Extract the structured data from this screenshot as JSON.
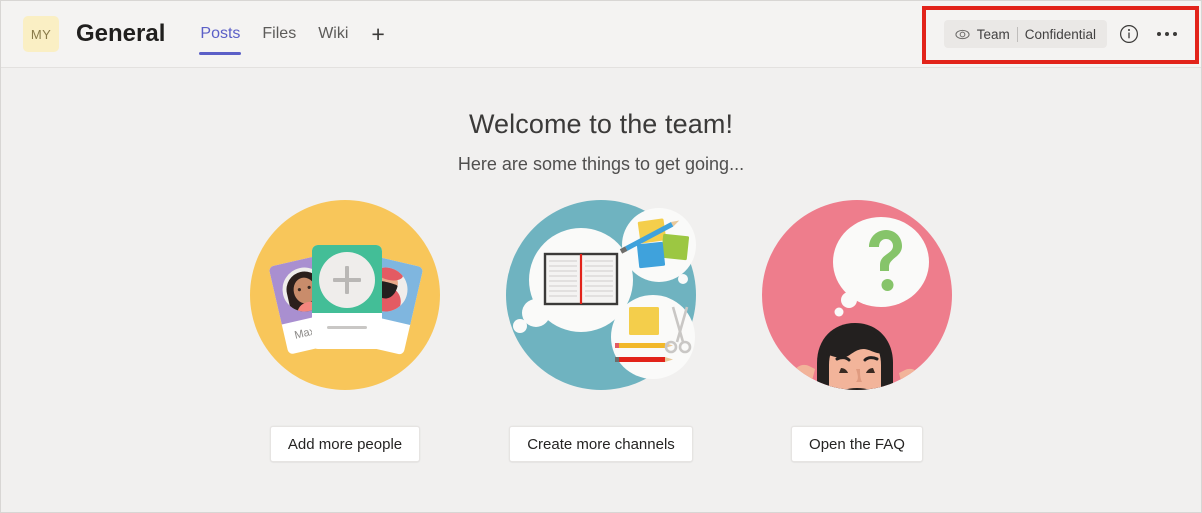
{
  "header": {
    "team_avatar_initials": "MY",
    "channel_title": "General",
    "tabs": [
      {
        "label": "Posts",
        "active": true
      },
      {
        "label": "Files",
        "active": false
      },
      {
        "label": "Wiki",
        "active": false
      }
    ],
    "add_tab_label": "+",
    "sensitivity": {
      "eye_icon": "eye-icon",
      "scope_label": "Team",
      "label": "Confidential"
    },
    "info_icon": "info-circle-icon",
    "more_icon": "ellipsis-icon"
  },
  "main": {
    "welcome_title": "Welcome to the team!",
    "welcome_subtitle": "Here are some things to get going...",
    "cards": [
      {
        "illustration": "people-cards-illustration",
        "button_label": "Add more people",
        "circle_color": "#F8C65A",
        "name_on_card": "Maxine"
      },
      {
        "illustration": "channels-notebook-illustration",
        "button_label": "Create more channels",
        "circle_color": "#6FB3C0"
      },
      {
        "illustration": "faq-question-illustration",
        "button_label": "Open the FAQ",
        "circle_color": "#EE7D8C"
      }
    ]
  },
  "annotation": {
    "highlight_color": "#E2231A",
    "name": "sensitivity-label-highlight"
  },
  "colors": {
    "page_background": "#F1F0EF",
    "header_background": "#F4F3F2",
    "accent": "#5B5FC7",
    "avatar_background": "#FAEFC4"
  }
}
